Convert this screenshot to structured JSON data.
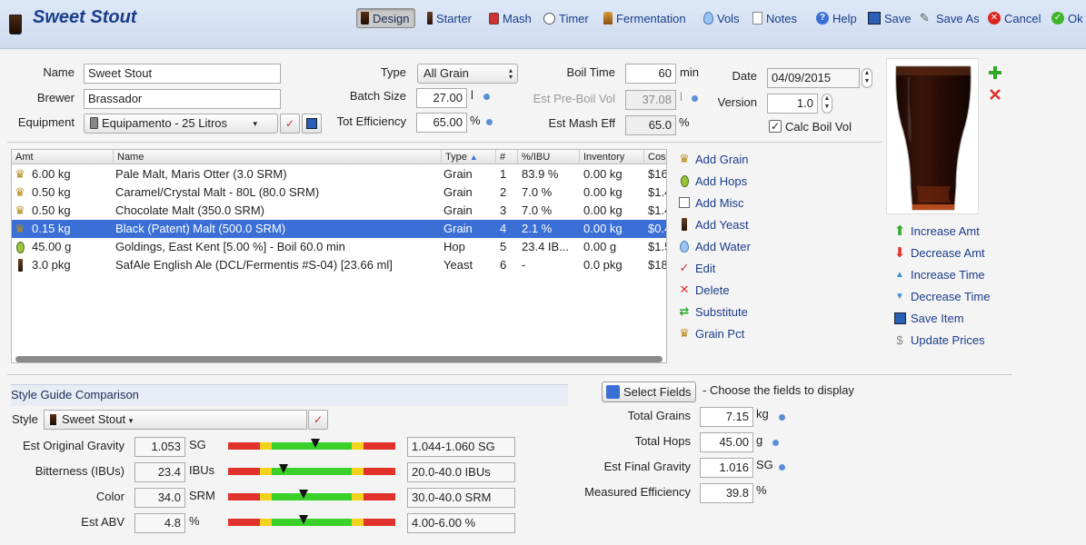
{
  "window": {
    "title": "Sweet Stout"
  },
  "toolbar": {
    "design": "Design",
    "starter": "Starter",
    "mash": "Mash",
    "timer": "Timer",
    "fermentation": "Fermentation",
    "vols": "Vols",
    "notes": "Notes",
    "help": "Help",
    "save": "Save",
    "save_as": "Save As",
    "cancel": "Cancel",
    "ok": "Ok"
  },
  "recipe": {
    "name_label": "Name",
    "name": "Sweet Stout",
    "brewer_label": "Brewer",
    "brewer": "Brassador",
    "equipment_label": "Equipment",
    "equipment": "Equipamento - 25 Litros",
    "type_label": "Type",
    "type": "All Grain",
    "batch_size_label": "Batch Size",
    "batch_size": "27.00",
    "batch_unit": "l",
    "tot_eff_label": "Tot Efficiency",
    "tot_eff": "65.00",
    "tot_eff_unit": "%",
    "boil_time_label": "Boil Time",
    "boil_time": "60",
    "boil_unit": "min",
    "pre_boil_label": "Est Pre-Boil Vol",
    "pre_boil": "37.08",
    "pre_boil_unit": "l",
    "mash_eff_label": "Est Mash Eff",
    "mash_eff": "65.0",
    "mash_eff_unit": "%",
    "date_label": "Date",
    "date": "04/09/2015",
    "version_label": "Version",
    "version": "1.0",
    "calc_boil_label": "Calc Boil Vol",
    "calc_boil_checked": true
  },
  "ingredients": {
    "columns": [
      "Amt",
      "Name",
      "Type",
      "#",
      "%/IBU",
      "Inventory",
      "Cos"
    ],
    "rows": [
      {
        "icon": "grain-icon",
        "amt": "6.00 kg",
        "name": "Pale Malt, Maris Otter (3.0 SRM)",
        "type": "Grain",
        "num": "1",
        "pct": "83.9 %",
        "inv": "0.00 kg",
        "cost": "$16"
      },
      {
        "icon": "grain-icon",
        "amt": "0.50 kg",
        "name": "Caramel/Crystal Malt - 80L (80.0 SRM)",
        "type": "Grain",
        "num": "2",
        "pct": "7.0 %",
        "inv": "0.00 kg",
        "cost": "$1.4"
      },
      {
        "icon": "grain-icon",
        "amt": "0.50 kg",
        "name": "Chocolate Malt (350.0 SRM)",
        "type": "Grain",
        "num": "3",
        "pct": "7.0 %",
        "inv": "0.00 kg",
        "cost": "$1.4"
      },
      {
        "icon": "grain-icon",
        "amt": "0.15 kg",
        "name": "Black (Patent) Malt (500.0 SRM)",
        "type": "Grain",
        "num": "4",
        "pct": "2.1 %",
        "inv": "0.00 kg",
        "cost": "$0.4"
      },
      {
        "icon": "hop-icon",
        "amt": "45.00 g",
        "name": "Goldings, East Kent [5.00 %] - Boil 60.0 min",
        "type": "Hop",
        "num": "5",
        "pct": "23.4 IB...",
        "inv": "0.00 g",
        "cost": "$1.5"
      },
      {
        "icon": "yeast-icon",
        "amt": "3.0 pkg",
        "name": "SafAle English Ale (DCL/Fermentis #S-04) [23.66 ml]",
        "type": "Yeast",
        "num": "6",
        "pct": "-",
        "inv": "0.0 pkg",
        "cost": "$18"
      }
    ],
    "selected_row": 3
  },
  "actions": {
    "add_grain": "Add Grain",
    "add_hops": "Add Hops",
    "add_misc": "Add Misc",
    "add_yeast": "Add Yeast",
    "add_water": "Add Water",
    "edit": "Edit",
    "delete": "Delete",
    "substitute": "Substitute",
    "grain_pct": "Grain Pct"
  },
  "amount_actions": {
    "increase_amt": "Increase Amt",
    "decrease_amt": "Decrease Amt",
    "increase_time": "Increase Time",
    "decrease_time": "Decrease Time",
    "save_item": "Save Item",
    "update_prices": "Update Prices"
  },
  "style_guide": {
    "section_title": "Style Guide Comparison",
    "style_label": "Style",
    "style": "Sweet Stout",
    "rows": [
      {
        "label": "Est Original Gravity",
        "value": "1.053",
        "unit": "SG",
        "range": "1.044-1.060 SG",
        "marker": 0.52
      },
      {
        "label": "Bitterness (IBUs)",
        "value": "23.4",
        "unit": "IBUs",
        "range": "20.0-40.0 IBUs",
        "marker": 0.33
      },
      {
        "label": "Color",
        "value": "34.0",
        "unit": "SRM",
        "range": "30.0-40.0 SRM",
        "marker": 0.45
      },
      {
        "label": "Est ABV",
        "value": "4.8",
        "unit": "%",
        "range": "4.00-6.00 %",
        "marker": 0.45
      }
    ]
  },
  "fields": {
    "select_fields": "Select Fields",
    "choose_hint": "- Choose the fields to display",
    "total_grains_label": "Total Grains",
    "total_grains": "7.15",
    "total_grains_unit": "kg",
    "total_hops_label": "Total Hops",
    "total_hops": "45.00",
    "total_hops_unit": "g",
    "final_gravity_label": "Est Final Gravity",
    "final_gravity": "1.016",
    "final_gravity_unit": "SG",
    "measured_eff_label": "Measured Efficiency",
    "measured_eff": "39.8",
    "measured_eff_unit": "%"
  },
  "colors": {
    "link": "#1a3d8a",
    "selection": "#3a6fd6",
    "meter_red": "#e0312b",
    "meter_yellow": "#f2d21b",
    "meter_green": "#39d12a",
    "beer_dark": "#2a0f06"
  }
}
